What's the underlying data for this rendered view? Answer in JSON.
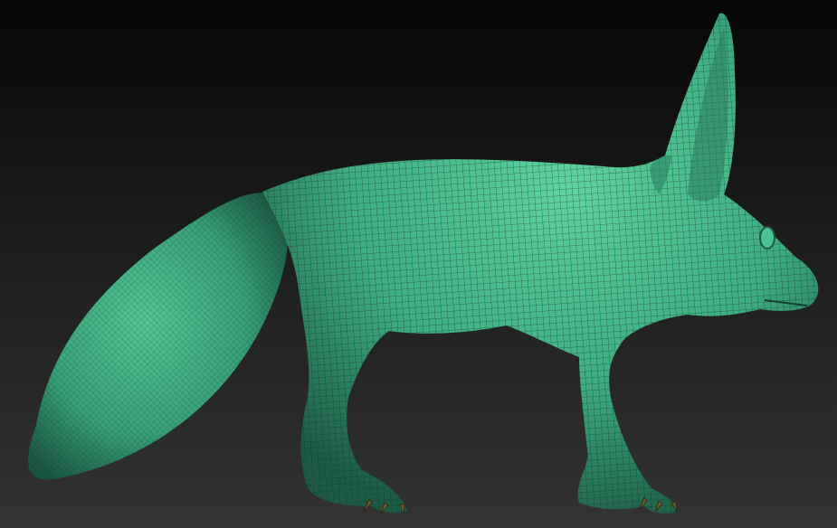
{
  "scene": {
    "subject": "fox-model",
    "colors": {
      "mesh_base": "#3fae82",
      "mesh_highlight": "#6fe0b0",
      "mesh_shadow": "#1d5a44",
      "wire": "#0f3325",
      "claw": "#6b5a2a",
      "background_top": "#070707",
      "background_bottom": "#333333"
    }
  }
}
